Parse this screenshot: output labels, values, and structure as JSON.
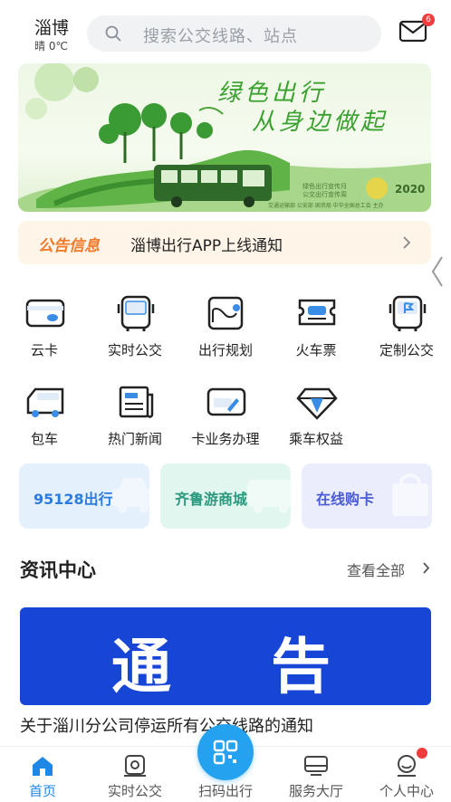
{
  "header": {
    "city": "淄博",
    "weather": "晴 0℃",
    "search_placeholder": "搜索公交线路、站点",
    "mail_badge": "6"
  },
  "banner": {
    "title_line1": "绿色出行",
    "title_line2": "从身边做起",
    "subtitle_line1": "绿色出行宣传月",
    "subtitle_line2": "公交出行宣传周",
    "year": "2020",
    "footer": "交通运输部 公安部 国资局 中华全国总工会 主办"
  },
  "notice": {
    "tag": "公告信息",
    "text": "淄博出行APP上线通知"
  },
  "services": [
    {
      "label": "云卡",
      "icon": "card-icon"
    },
    {
      "label": "实时公交",
      "icon": "bus-icon"
    },
    {
      "label": "出行规划",
      "icon": "route-map-icon"
    },
    {
      "label": "火车票",
      "icon": "train-ticket-icon"
    },
    {
      "label": "定制公交",
      "icon": "custom-bus-icon"
    },
    {
      "label": "包车",
      "icon": "charter-bus-icon"
    },
    {
      "label": "热门新闻",
      "icon": "newspaper-icon"
    },
    {
      "label": "卡业务办理",
      "icon": "card-service-icon"
    },
    {
      "label": "乘车权益",
      "icon": "diamond-icon"
    }
  ],
  "shortcuts": [
    {
      "label": "95128出行",
      "color": "#2c7be0",
      "bg": "#e4f0fc"
    },
    {
      "label": "齐鲁游商城",
      "color": "#2a9a7e",
      "bg": "#e2f6f0"
    },
    {
      "label": "在线购卡",
      "color": "#4a5bd6",
      "bg": "#ebedfc"
    }
  ],
  "news": {
    "section_title": "资讯中心",
    "more_label": "查看全部",
    "image_text": "通告",
    "item_title": "关于淄川分公司停运所有公交线路的通知"
  },
  "tabbar": {
    "items": [
      {
        "label": "首页",
        "icon": "home-icon",
        "active": true
      },
      {
        "label": "实时公交",
        "icon": "realtime-bus-icon",
        "active": false
      },
      {
        "label": "扫码出行",
        "icon": "qr-scan-icon",
        "active": false
      },
      {
        "label": "服务大厅",
        "icon": "service-hall-icon",
        "active": false
      },
      {
        "label": "个人中心",
        "icon": "profile-icon",
        "active": false
      }
    ]
  },
  "colors": {
    "accent": "#1f88e6",
    "scan_button": "#24a2ef",
    "notice_tag": "#f07a2a",
    "badge": "#f23b3b"
  }
}
